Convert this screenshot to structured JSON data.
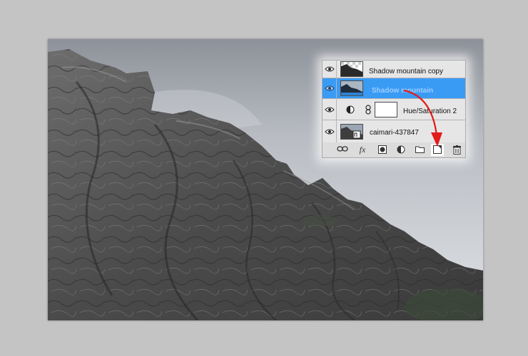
{
  "layers_panel": {
    "layers": [
      {
        "name": "Shadow mountain copy",
        "visible": true,
        "selected": false,
        "thumbnail": "transparent-checker-mountain"
      },
      {
        "name": "Shadow mountain",
        "visible": true,
        "selected": true,
        "thumbnail": "mountain-photo"
      },
      {
        "name": "Hue/Saturation 2",
        "visible": true,
        "selected": false,
        "thumbnail": "adjustment-layer-mask",
        "adjustment": true
      },
      {
        "name": "caimari-437847",
        "visible": true,
        "selected": false,
        "thumbnail": "smart-object-photo"
      }
    ],
    "footer_icons": [
      "link-icon",
      "fx-icon",
      "mask-icon",
      "adjustment-icon",
      "folder-icon",
      "new-layer-icon",
      "trash-icon"
    ],
    "highlight_icon": "new-layer-icon"
  },
  "colors": {
    "selection": "#3a9bf5",
    "arrow": "#e21b1b",
    "canvas_bg": "#c4c4c4"
  }
}
